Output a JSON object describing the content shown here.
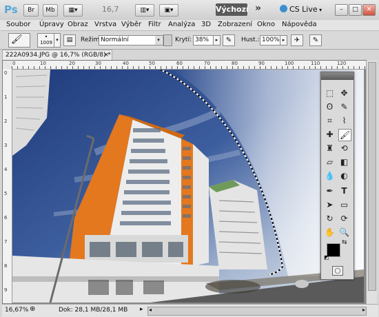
{
  "appbar": {
    "logo": "Ps",
    "br_label": "Br",
    "mb_label": "Mb",
    "zoom": "16,7",
    "workspace": "Výchozí",
    "chevron": "»",
    "cs_live": "CS Live"
  },
  "menu": [
    "Soubor",
    "Úpravy",
    "Obraz",
    "Vrstva",
    "Výběr",
    "Filtr",
    "Analýza",
    "3D",
    "Zobrazení",
    "Okno",
    "Nápověda"
  ],
  "options": {
    "brush_size": "1009",
    "mode_label": "Režim:",
    "mode_value": "Normální",
    "opacity_label": "Krytí:",
    "opacity_value": "38%",
    "flow_label": "Hust.:",
    "flow_value": "100%"
  },
  "document": {
    "tab_title": "222A0934.JPG @ 16,7% (RGB/8) *",
    "ruler_h": [
      "0",
      "10",
      "20",
      "30",
      "40",
      "50",
      "60",
      "70",
      "80",
      "90",
      "100",
      "110",
      "120"
    ],
    "ruler_v": [
      "0",
      "1",
      "2",
      "3",
      "4",
      "5",
      "6",
      "7",
      "8",
      "9"
    ]
  },
  "status": {
    "zoom": "16,67%",
    "doc": "Dok: 28,1 MB/28,1 MB"
  },
  "colors": {
    "workspace_bg": "#5a5a5a",
    "sky_top": "#1e3a7a",
    "building_orange": "#e3781f",
    "building_white": "#ececec"
  },
  "tools": [
    "move-icon",
    "marquee-icon",
    "lasso-icon",
    "quick-select-icon",
    "crop-icon",
    "eyedropper-icon",
    "healing-icon",
    "brush-icon",
    "clone-stamp-icon",
    "history-brush-icon",
    "eraser-icon",
    "gradient-icon",
    "blur-icon",
    "dodge-icon",
    "pen-icon",
    "type-icon",
    "path-select-icon",
    "shape-icon",
    "3d-rotate-icon",
    "3d-camera-icon",
    "hand-icon",
    "zoom-icon"
  ]
}
